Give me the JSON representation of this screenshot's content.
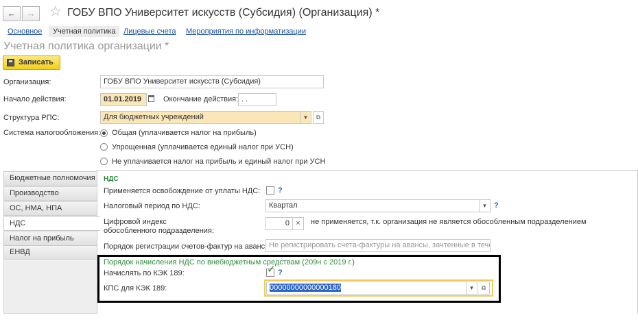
{
  "window": {
    "title": "ГОБУ ВПО Университет искусств (Субсидия) (Организация) *",
    "back_icon": "←",
    "forward_icon": "→"
  },
  "tabs": [
    "Основное",
    "Учетная политика",
    "Лицевые счета",
    "Мероприятия по информатизации"
  ],
  "page_title": "Учетная политика организации *",
  "save_label": "Записать",
  "form": {
    "org_label": "Организация:",
    "org_value": "ГОБУ ВПО Университет искусств (Субсидия)",
    "start_label": "Начало действия:",
    "start_value": "01.01.2019",
    "end_label": "Окончание действия:",
    "end_value": " .  .",
    "rps_label": "Структура РПС:",
    "rps_value": "Для бюджетных учреждений",
    "tax_label": "Система налогообложения:",
    "tax_options": [
      "Общая (уплачивается налог на прибыль)",
      "Упрощенная (уплачивается единый налог при УСН)",
      "Не уплачивается налог на прибыль и единый налог при УСН"
    ],
    "tax_selected": 0
  },
  "side_tabs": [
    "Бюджетные полномочия",
    "Производство",
    "ОС, НМА, НПА",
    "НДС",
    "Налог на прибыль",
    "ЕНВД"
  ],
  "side_active": 3,
  "nds": {
    "header": "НДС",
    "exempt_label": "Применяется освобождение от уплаты НДС:",
    "period_label": "Налоговый период по НДС:",
    "period_value": "Квартал",
    "digital_label1": "Цифровой индекс",
    "digital_label2": "обособленного подразделения:",
    "digital_value": "0",
    "digital_note": "не применяется, т.к. организация не является обособленным подразделением",
    "invoice_label": "Порядок регистрации счетов-фактур на аванс:",
    "invoice_value": "Не регистрировать счета-фактуры на авансы, зачтенные в течен",
    "section_header": "Порядок начисления НДС по внебюджетным средствам (209н с 2019 г.)",
    "kek_label": "Начислять по КЭК 189:",
    "kps_label": "КПС для КЭК 189:",
    "kps_value": "00000000000000180",
    "help": "?",
    "clear": "×"
  }
}
